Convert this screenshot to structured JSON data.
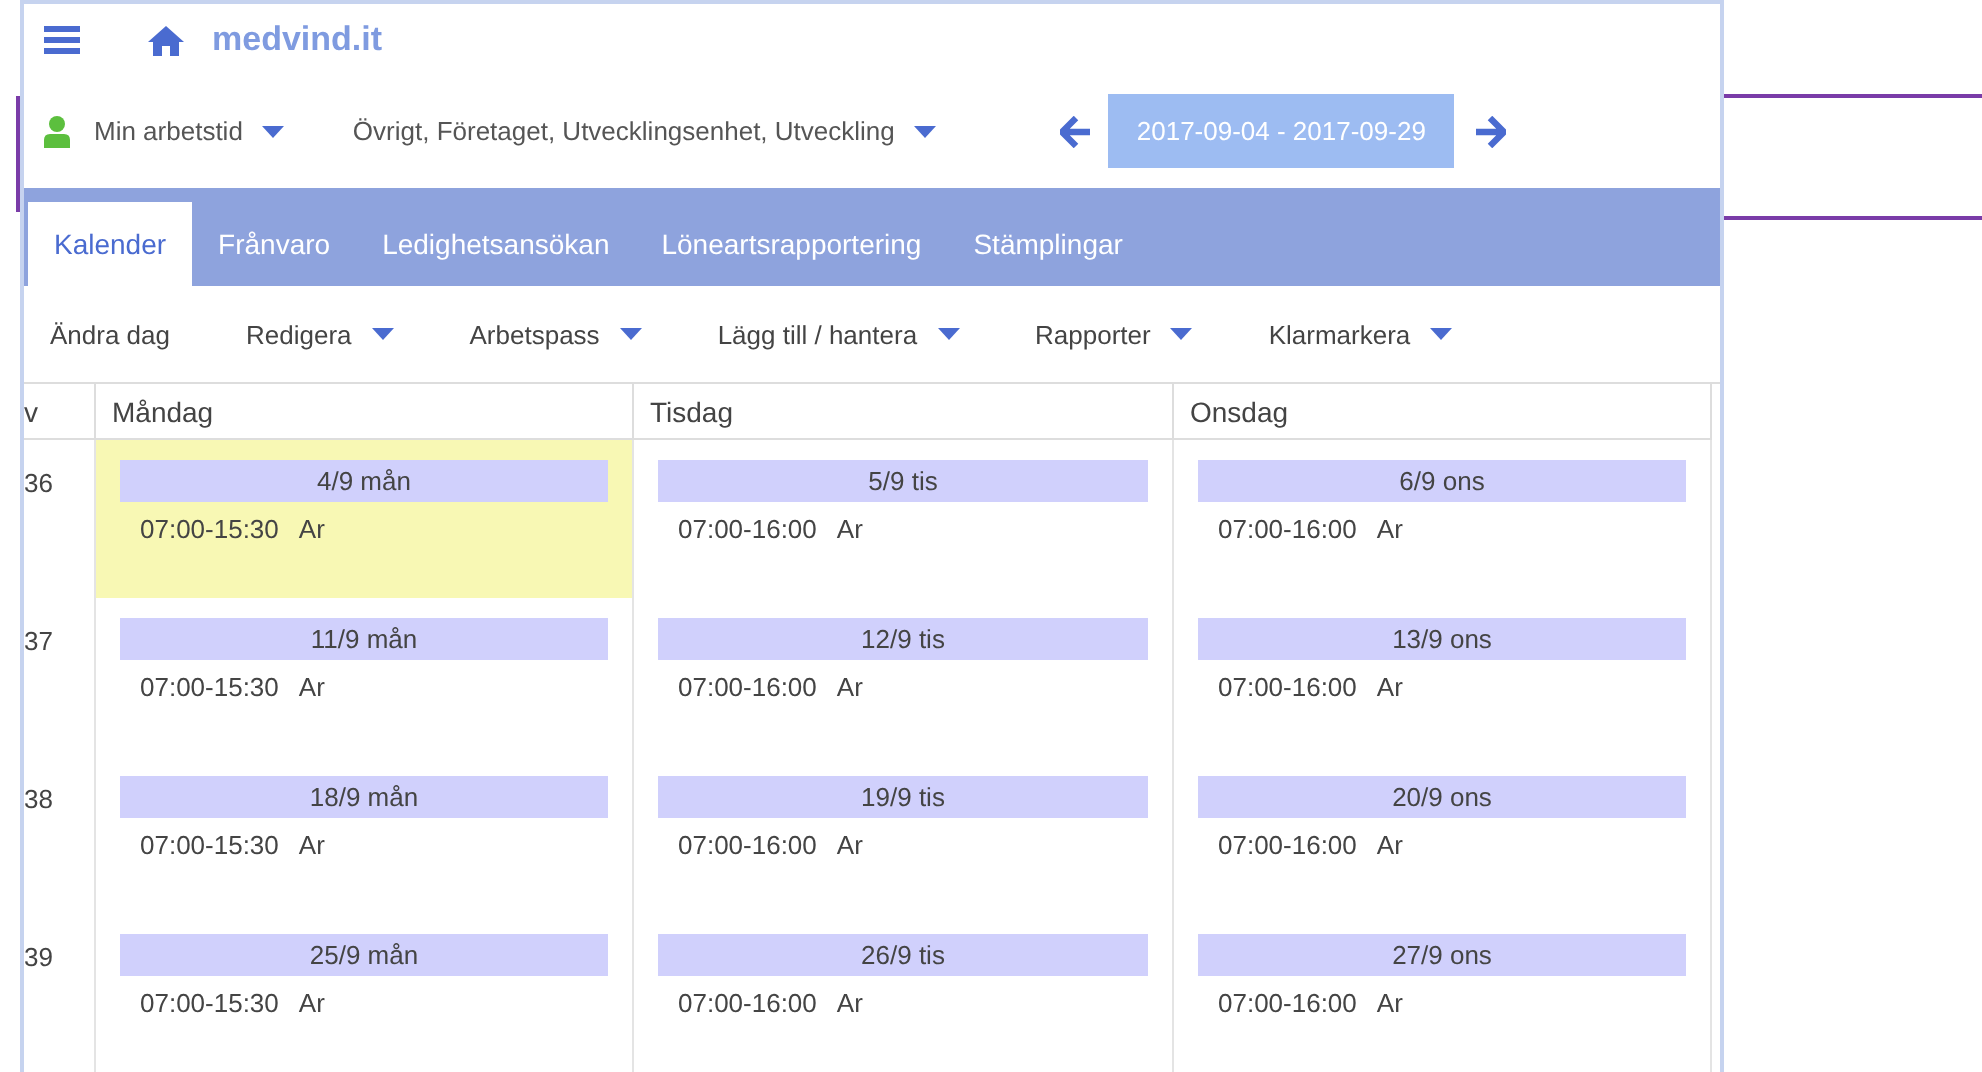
{
  "header": {
    "brand": "medvind.it"
  },
  "filters": {
    "person": "Min arbetstid",
    "unit": "Övrigt, Företaget, Utvecklingsenhet, Utveckling",
    "period": "2017-09-04 - 2017-09-29"
  },
  "tabs": [
    {
      "label": "Kalender",
      "selected": true
    },
    {
      "label": "Frånvaro",
      "selected": false
    },
    {
      "label": "Ledighetsansökan",
      "selected": false
    },
    {
      "label": "Löneartsrapportering",
      "selected": false
    },
    {
      "label": "Stämplingar",
      "selected": false
    }
  ],
  "toolbar": [
    {
      "label": "Ändra dag",
      "dropdown": false
    },
    {
      "label": "Redigera",
      "dropdown": true
    },
    {
      "label": "Arbetspass",
      "dropdown": true
    },
    {
      "label": "Lägg till / hantera",
      "dropdown": true
    },
    {
      "label": "Rapporter",
      "dropdown": true
    },
    {
      "label": "Klarmarkera",
      "dropdown": true
    }
  ],
  "calendar": {
    "columns": [
      "v",
      "Måndag",
      "Tisdag",
      "Onsdag"
    ],
    "weeks": [
      {
        "week": "36",
        "days": [
          {
            "date": "4/9 mån",
            "time": "07:00-15:30",
            "code": "Ar",
            "today": true
          },
          {
            "date": "5/9 tis",
            "time": "07:00-16:00",
            "code": "Ar",
            "today": false
          },
          {
            "date": "6/9 ons",
            "time": "07:00-16:00",
            "code": "Ar",
            "today": false
          }
        ]
      },
      {
        "week": "37",
        "days": [
          {
            "date": "11/9 mån",
            "time": "07:00-15:30",
            "code": "Ar",
            "today": false
          },
          {
            "date": "12/9 tis",
            "time": "07:00-16:00",
            "code": "Ar",
            "today": false
          },
          {
            "date": "13/9 ons",
            "time": "07:00-16:00",
            "code": "Ar",
            "today": false
          }
        ]
      },
      {
        "week": "38",
        "days": [
          {
            "date": "18/9 mån",
            "time": "07:00-15:30",
            "code": "Ar",
            "today": false
          },
          {
            "date": "19/9 tis",
            "time": "07:00-16:00",
            "code": "Ar",
            "today": false
          },
          {
            "date": "20/9 ons",
            "time": "07:00-16:00",
            "code": "Ar",
            "today": false
          }
        ]
      },
      {
        "week": "39",
        "days": [
          {
            "date": "25/9 mån",
            "time": "07:00-15:30",
            "code": "Ar",
            "today": false
          },
          {
            "date": "26/9 tis",
            "time": "07:00-16:00",
            "code": "Ar",
            "today": false
          },
          {
            "date": "27/9 ons",
            "time": "07:00-16:00",
            "code": "Ar",
            "today": false
          }
        ]
      }
    ]
  }
}
